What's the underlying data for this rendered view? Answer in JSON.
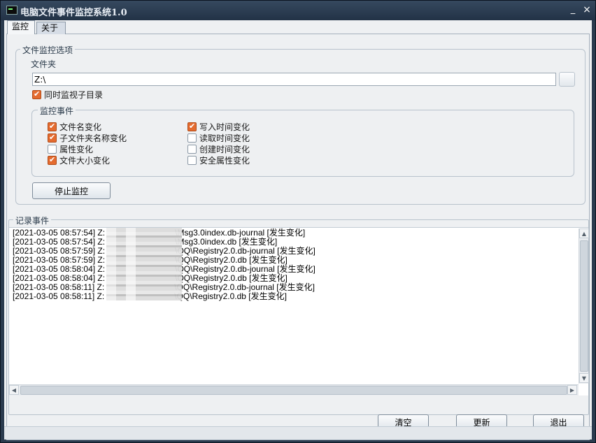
{
  "window": {
    "title": "电脑文件事件监控系统1.0",
    "minimize_glyph": "_",
    "close_glyph": "×"
  },
  "tabs": [
    {
      "label": "监控",
      "selected": true
    },
    {
      "label": "关于",
      "selected": false
    }
  ],
  "options": {
    "group_title": "文件监控选项",
    "folder_label": "文件夹",
    "folder_value": "Z:\\",
    "include_subdirs": {
      "label": "同时监视子目录",
      "checked": true
    },
    "events": {
      "group_title": "监控事件",
      "items": [
        {
          "label": "文件名变化",
          "checked": true
        },
        {
          "label": "子文件夹名称变化",
          "checked": true
        },
        {
          "label": "属性变化",
          "checked": false
        },
        {
          "label": "文件大小变化",
          "checked": true
        },
        {
          "label": "写入时间变化",
          "checked": true
        },
        {
          "label": "读取时间变化",
          "checked": false
        },
        {
          "label": "创建时间变化",
          "checked": false
        },
        {
          "label": "安全属性变化",
          "checked": false
        }
      ]
    },
    "stop_button": "停止监控"
  },
  "log": {
    "group_title": "记录事件",
    "lines": [
      "[2021-03-05 08:57:54] Z:                              \\Msg3.0index.db-journal [发生变化]",
      "[2021-03-05 08:57:54] Z:                              \\Msg3.0index.db [发生变化]",
      "[2021-03-05 08:57:59] Z:                              \\QQ\\Registry2.0.db-journal [发生变化]",
      "[2021-03-05 08:57:59] Z:                              \\QQ\\Registry2.0.db [发生变化]",
      "[2021-03-05 08:58:04] Z:                              \\QQ\\Registry2.0.db-journal [发生变化]",
      "[2021-03-05 08:58:04] Z:                              \\QQ\\Registry2.0.db [发生变化]",
      "[2021-03-05 08:58:11] Z:                              \\QQ\\Registry2.0.db-journal [发生变化]",
      "[2021-03-05 08:58:11] Z:                              \\QQ\\Registry2.0.db [发生变化]"
    ]
  },
  "buttons": {
    "clear": "清空",
    "refresh": "更新",
    "exit": "退出"
  },
  "accent_color": "#e46b2f"
}
